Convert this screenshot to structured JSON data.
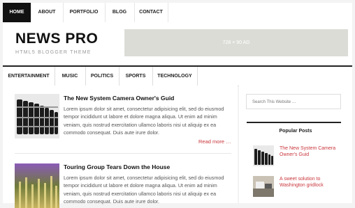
{
  "top_nav": [
    "HOME",
    "ABOUT",
    "PORTFOLIO",
    "BLOG",
    "CONTACT"
  ],
  "header": {
    "site_title": "NEWS PRO",
    "site_description": "HTML5 BLOGGER THEME",
    "ad_label": "728 × 90 AD"
  },
  "category_nav": [
    "ENTERTAINMENT",
    "MUSIC",
    "POLITICS",
    "SPORTS",
    "TECHNOLOGY"
  ],
  "posts": [
    {
      "title": "The New System Camera Owner's Guid",
      "excerpt": "Lorem ipsum dolor sit amet, consectetur adipisicing elit, sed do eiusmod tempor incididunt ut labore et dolore magna aliqua. Ut enim ad minim veniam, quis nostrud exercitation ullamco laboris nisi ut aliquip ex ea commodo consequat. Duis aute irure dolor.",
      "read_more": "Read more …"
    },
    {
      "title": "Touring Group Tears Down the House",
      "excerpt": "Lorem ipsum dolor sit amet, consectetur adipisicing elit, sed do eiusmod tempor incididunt ut labore et dolore magna aliqua. Ut enim ad minim veniam, quis nostrud exercitation ullamco laboris nisi ut aliquip ex ea commodo consequat. Duis aute irure dolor."
    }
  ],
  "sidebar": {
    "search_placeholder": "Search This Website …",
    "popular_title": "Popular Posts",
    "popular_posts": [
      "The New System Camera Owner's Guid",
      "A sweet solution to Washington gridlock"
    ]
  },
  "colors": {
    "accent": "#c9363c",
    "nav_active": "#111111",
    "ad_bg": "#dcdcd7"
  }
}
